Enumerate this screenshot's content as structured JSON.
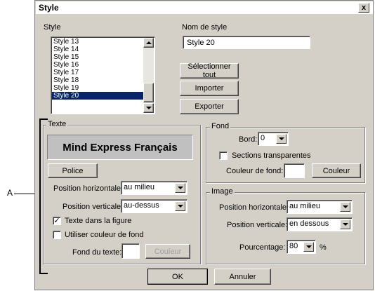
{
  "window": {
    "title": "Style",
    "close_glyph": "x"
  },
  "style_list": {
    "label": "Style",
    "items": [
      "Style 13",
      "Style 14",
      "Style 15",
      "Style 16",
      "Style 17",
      "Style 18",
      "Style 19",
      "Style 20"
    ],
    "selected": "Style 20"
  },
  "style_name": {
    "label": "Nom de style",
    "value": "Style 20"
  },
  "buttons": {
    "select_all": "Sélectionner tout",
    "import": "Importer",
    "export": "Exporter",
    "ok": "OK",
    "cancel": "Annuler"
  },
  "texte": {
    "group_label": "Texte",
    "preview_text": "Mind Express Français",
    "font_button": "Police",
    "h_pos_label": "Position horizontale:",
    "h_pos_value": "au milieu",
    "v_pos_label": "Position verticale:",
    "v_pos_value": "au-dessus",
    "text_in_figure_label": "Texte dans la figure",
    "text_in_figure_checked": "✓",
    "use_bg_color_label": "Utiliser couleur de fond",
    "text_bg_label": "Fond du texte:",
    "color_button": "Couleur"
  },
  "fond": {
    "group_label": "Fond",
    "border_label": "Bord:",
    "border_value": "0",
    "transparent_label": "Sections transparentes",
    "bg_color_label": "Couleur de fond:",
    "color_button": "Couleur"
  },
  "image": {
    "group_label": "Image",
    "h_pos_label": "Position horizontale:",
    "h_pos_value": "au milieu",
    "v_pos_label": "Position verticale:",
    "v_pos_value": "en dessous",
    "percent_label": "Pourcentage:",
    "percent_value": "80",
    "percent_unit": "%"
  },
  "callout": {
    "label": "A"
  },
  "colors": {
    "dialog_bg": "#d4d0c8",
    "selection": "#0a246a",
    "preview_bg": "#c0c0c0"
  }
}
